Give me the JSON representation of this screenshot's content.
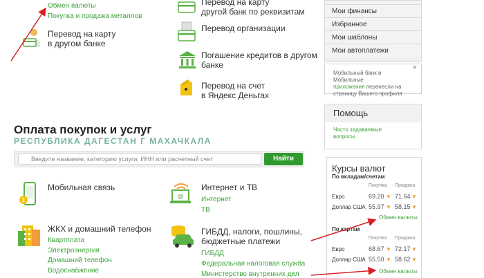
{
  "top_left": {
    "exchange_link": "Обмен валюты",
    "metals_link": "Покупка и продажа металлов",
    "card_transfer": {
      "line1": "Перевод на карту",
      "line2": "в другом банке"
    }
  },
  "top_mid": {
    "bank_transfer": {
      "line1": "Перевод на карту",
      "line2": "другой банк по реквизитам"
    },
    "org_transfer": "Перевод организации",
    "loan_payment": {
      "line1": "Погашение кредитов в другом",
      "line2": "банке"
    },
    "yandex": {
      "line1": "Перевод на счет",
      "line2": "в Яндекс Деньгах"
    }
  },
  "payments": {
    "title": "Оплата покупок и услуг",
    "region": "Республика Дагестан г Махачкала",
    "search_placeholder": "Введите название, категорию услуги, ИНН или расчетный счет",
    "search_button": "Найти"
  },
  "categories": {
    "mobile": {
      "title": "Мобильная связь"
    },
    "internet": {
      "title": "Интернет и ТВ",
      "links": [
        "Интернет",
        "ТВ"
      ]
    },
    "housing": {
      "title": "ЖКХ и домашний телефон",
      "links": [
        "Квартплата",
        "Электроэнергия",
        "Домашний телефон",
        "Водоснабжение"
      ]
    },
    "gibdd": {
      "title_line1": "ГИБДД, налоги, пошлины,",
      "title_line2": "бюджетные платежи",
      "links": [
        "ГИБДД",
        "Федеральная налоговая служба",
        "Министерство внутренних дел"
      ]
    }
  },
  "sidebar": {
    "menu": [
      "Мои финансы",
      "Избранное",
      "Мои шаблоны",
      "Мои автоплатежи"
    ],
    "notice": {
      "text1": "Мобильный банк и Мобильные",
      "text2_link": "приложения",
      "text2_rest": " перенесли на",
      "text3": "страницу Вашего профиля",
      "close": "×"
    },
    "help": {
      "title": "Помощь",
      "link_line1": "Часто задаваемые",
      "link_line2": "вопросы"
    }
  },
  "rates": {
    "title": "Курсы валют",
    "deposits_label": "По вкладам/счетам",
    "cards_label": "По картам",
    "buy_label": "Покупка",
    "sell_label": "Продажа",
    "deposits": [
      {
        "currency": "Евро",
        "buy": "69.20",
        "sell": "71.64"
      },
      {
        "currency": "Доллар США",
        "buy": "55.97",
        "sell": "58.15"
      }
    ],
    "cards": [
      {
        "currency": "Евро",
        "buy": "68.67",
        "sell": "72.17"
      },
      {
        "currency": "Доллар США",
        "buy": "55.50",
        "sell": "58.62"
      }
    ],
    "more_link": "Обмен валюты"
  },
  "colors": {
    "green": "#3fa53b",
    "button": "#2f9a2e",
    "arrow": "#d91f26",
    "orange": "#f29b38",
    "region": "#78b3a4"
  }
}
